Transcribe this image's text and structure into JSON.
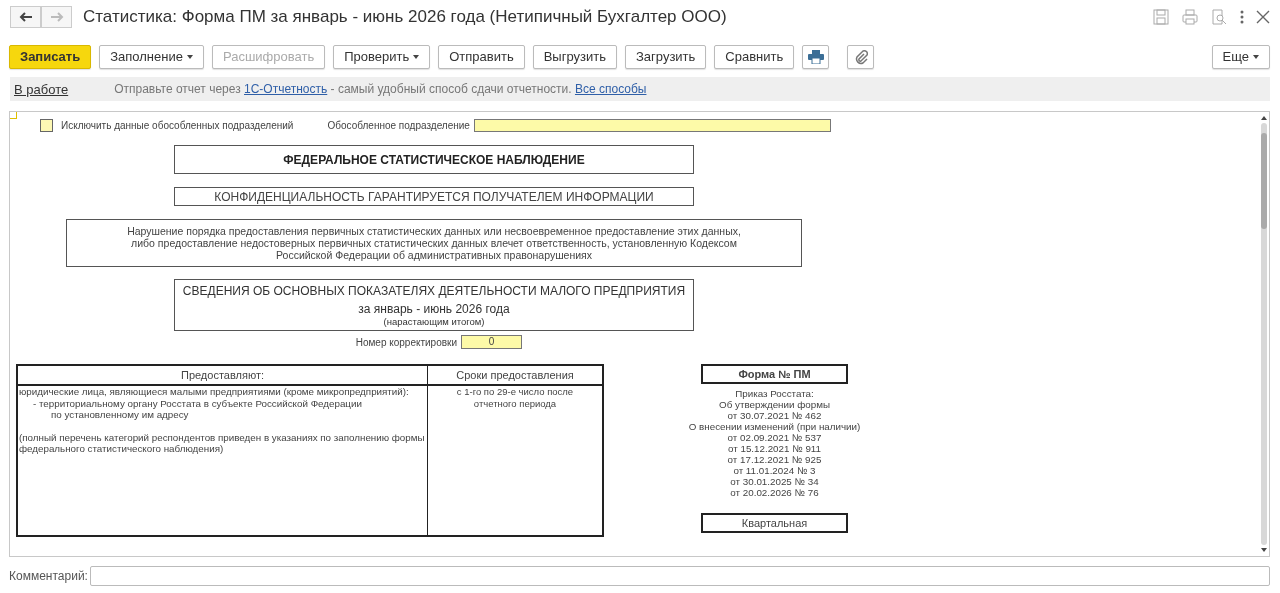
{
  "window": {
    "title": "Статистика: Форма ПМ за январь - июнь 2026 года (Нетипичный Бухгалтер ООО)",
    "back_disabled": false,
    "forward_disabled": true
  },
  "toolbar": {
    "buttons": [
      {
        "label": "Записать",
        "default": true,
        "disabled": false,
        "has_menu": false
      },
      {
        "label": "Заполнение",
        "default": false,
        "disabled": false,
        "has_menu": true
      },
      {
        "label": "Расшифровать",
        "default": false,
        "disabled": true,
        "has_menu": false
      },
      {
        "label": "Проверить",
        "default": false,
        "disabled": false,
        "has_menu": true
      },
      {
        "label": "Отправить",
        "default": false,
        "disabled": false,
        "has_menu": false
      },
      {
        "label": "Выгрузить",
        "default": false,
        "disabled": false,
        "has_menu": false
      },
      {
        "label": "Загрузить",
        "default": false,
        "disabled": false,
        "has_menu": false
      },
      {
        "label": "Сравнить",
        "default": false,
        "disabled": false,
        "has_menu": false
      }
    ],
    "more": {
      "label": "Еще",
      "has_menu": true
    }
  },
  "info_bar": {
    "status": "В работе",
    "message": [
      {
        "kind": "text",
        "text": "Отправьте отчет через "
      },
      {
        "kind": "link",
        "text": "1С-Отчетность"
      },
      {
        "kind": "text",
        "text": " - самый удобный способ сдачи отчетности. "
      },
      {
        "kind": "link",
        "text": "Все способы"
      }
    ]
  },
  "report": {
    "exclude_checkbox": {
      "label": "Исключить данные обособленных подразделений",
      "checked": false
    },
    "subdivision": {
      "label": "Обособленное подразделение"
    },
    "header_boxes": [
      {
        "kind": "bold",
        "lines": [
          "ФЕДЕРАЛЬНОЕ СТАТИСТИЧЕСКОЕ НАБЛЮДЕНИЕ"
        ]
      },
      {
        "kind": "plain",
        "lines": [
          "КОНФИДЕНЦИАЛЬНОСТЬ ГАРАНТИРУЕТСЯ ПОЛУЧАТЕЛЕМ ИНФОРМАЦИИ"
        ]
      },
      {
        "kind": "wide",
        "lines": [
          "Нарушение порядка предоставления первичных статистических данных или несвоевременное предоставление этих данных,",
          "либо предоставление недостоверных первичных статистических данных влечет ответственность, установленную Кодексом",
          "Российской Федерации об административных правонарушениях"
        ]
      },
      {
        "kind": "title",
        "lines": [
          "СВЕДЕНИЯ ОБ ОСНОВНЫХ ПОКАЗАТЕЛЯХ ДЕЯТЕЛЬНОСТИ МАЛОГО ПРЕДПРИЯТИЯ",
          "за январь - июнь 2026 года",
          "(нарастающим итогом)"
        ]
      }
    ],
    "correction": {
      "label": "Номер корректировки",
      "value": "0"
    },
    "table": {
      "columns": [
        "Предоставляют:",
        "Сроки предоставления"
      ],
      "respondents": [
        {
          "text": "юридические лица, являющиеся малыми предприятиями (кроме микропредприятий):",
          "children": [
            {
              "text": "- территориальному органу Росстата в субъекте Российской Федерации",
              "children": [
                {
                  "text": "по установленному им адресу"
                }
              ]
            }
          ]
        },
        {
          "text": "(полный перечень категорий респондентов приведен в указаниях по заполнению формы федерального статистического наблюдения)"
        }
      ],
      "deadline": "с 1-го по 29-е число после отчетного периода"
    },
    "form": {
      "title": "Форма № ПМ",
      "lines": [
        "Приказ Росстата:",
        "Об утверждении формы",
        "от 30.07.2021 № 462",
        "О внесении изменений (при наличии)",
        "от 02.09.2021 № 537",
        "от 15.12.2021 № 911",
        "от 17.12.2021 № 925",
        "от 11.01.2024 № 3",
        "от 30.01.2025 № 34",
        "от 20.02.2026 № 76"
      ],
      "periodicity": "Квартальная"
    }
  },
  "comment": {
    "label": "Комментарий:"
  }
}
